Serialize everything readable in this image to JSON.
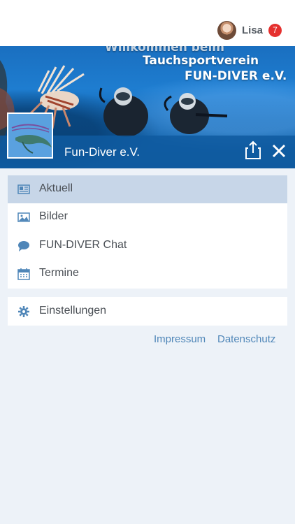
{
  "topbar": {
    "username": "Lisa",
    "badge_count": "7"
  },
  "banner": {
    "line1": "Willkommen beim",
    "line2": "Tauchsportverein",
    "line3": "FUN-DIVER e.V.",
    "club_name": "Fun-Diver e.V."
  },
  "menu": {
    "items": [
      {
        "label": "Aktuell",
        "icon": "newspaper-icon",
        "active": true
      },
      {
        "label": "Bilder",
        "icon": "image-icon",
        "active": false
      },
      {
        "label": "FUN-DIVER Chat",
        "icon": "chat-bubble-icon",
        "active": false
      },
      {
        "label": "Termine",
        "icon": "calendar-icon",
        "active": false
      }
    ],
    "settings_label": "Einstellungen"
  },
  "footer": {
    "impressum": "Impressum",
    "datenschutz": "Datenschutz"
  },
  "colors": {
    "accent": "#4f86b8",
    "badge": "#e5302e",
    "active_row": "#c7d6e8",
    "background": "#edf2f8"
  }
}
